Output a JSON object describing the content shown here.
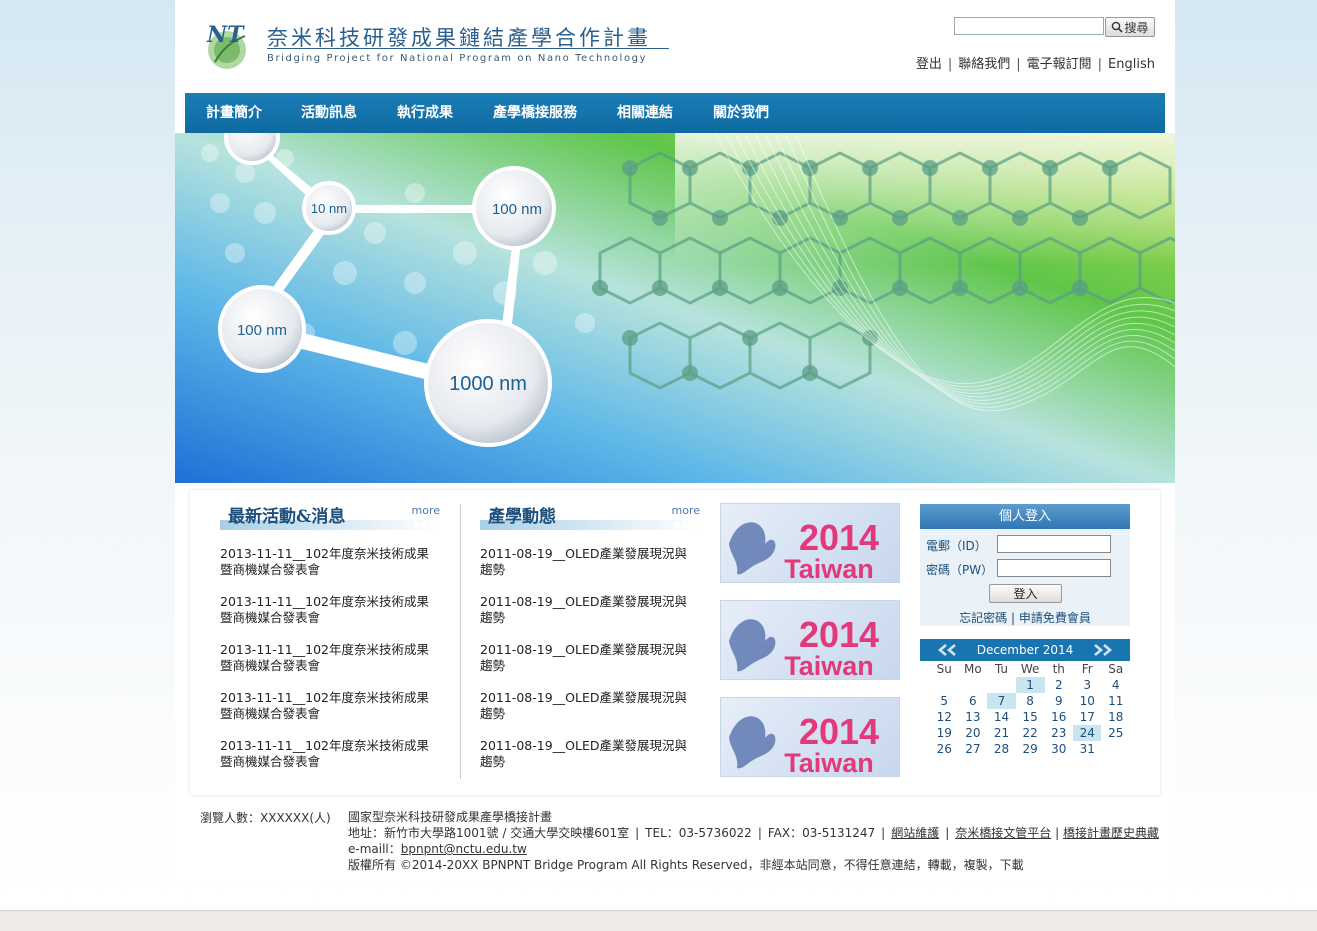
{
  "brand": {
    "logo_mark": "NT",
    "title_zh": "奈米科技研發成果鏈結產學合作計畫",
    "title_en": "Bridging Project for National Program on Nano Technology"
  },
  "search": {
    "placeholder": "",
    "button_label": "搜尋"
  },
  "top_links": [
    "登出",
    "聯絡我們",
    "電子報訂閱",
    "English"
  ],
  "nav": [
    "計畫簡介",
    "活動訊息",
    "執行成果",
    "產學橋接服務",
    "相關連結",
    "關於我們"
  ],
  "banner": {
    "labels": [
      "10 nm",
      "100 nm",
      "100 nm",
      "1000 nm"
    ]
  },
  "news": {
    "title": "最新活動&消息",
    "more": "more",
    "items": [
      [
        "2013-11-11__102年度奈米技術成果",
        "暨商機媒合發表會"
      ],
      [
        "2013-11-11__102年度奈米技術成果",
        "暨商機媒合發表會"
      ],
      [
        "2013-11-11__102年度奈米技術成果",
        "暨商機媒合發表會"
      ],
      [
        "2013-11-11__102年度奈米技術成果",
        "暨商機媒合發表會"
      ],
      [
        "2013-11-11__102年度奈米技術成果",
        "暨商機媒合發表會"
      ]
    ]
  },
  "industry": {
    "title": "產學動態",
    "more": "more",
    "items": [
      [
        "2011-08-19__OLED產業發展現況與",
        "趨勢"
      ],
      [
        "2011-08-19__OLED產業發展現況與",
        "趨勢"
      ],
      [
        "2011-08-19__OLED產業發展現況與",
        "趨勢"
      ],
      [
        "2011-08-19__OLED產業發展現況與",
        "趨勢"
      ],
      [
        "2011-08-19__OLED產業發展現況與",
        "趨勢"
      ]
    ]
  },
  "ads": [
    {
      "year": "2014",
      "text": "Taiwan"
    },
    {
      "year": "2014",
      "text": "Taiwan"
    },
    {
      "year": "2014",
      "text": "Taiwan"
    }
  ],
  "login": {
    "title": "個人登入",
    "id_label": "電郵（ID）",
    "pw_label": "密碼（PW）",
    "button": "登入",
    "forgot": "忘記密碼",
    "register": "申請免費會員"
  },
  "calendar": {
    "month_label": "December 2014",
    "weekdays": [
      "Su",
      "Mo",
      "Tu",
      "We",
      "th",
      "Fr",
      "Sa"
    ],
    "weeks": [
      [
        "",
        "",
        "",
        "1",
        "2",
        "3",
        "4"
      ],
      [
        "5",
        "6",
        "7",
        "8",
        "9",
        "10",
        "11"
      ],
      [
        "12",
        "13",
        "14",
        "15",
        "16",
        "17",
        "18"
      ],
      [
        "19",
        "20",
        "21",
        "22",
        "23",
        "24",
        "25"
      ],
      [
        "26",
        "27",
        "28",
        "29",
        "30",
        "31",
        ""
      ]
    ],
    "highlighted": [
      "1",
      "7",
      "24"
    ]
  },
  "footer": {
    "visitors": "瀏覽人數：XXXXXX(人)",
    "org": "國家型奈米科技研發成果產學橋接計畫",
    "address": "地址：新竹市大學路1001號 / 交通大學交映樓601室",
    "tel": "TEL：03-5736022",
    "fax": "FAX：03-5131247",
    "links": [
      "網站維護",
      "奈米橋接文管平台",
      "橋接計畫歷史典藏"
    ],
    "email_label": "e-maill：",
    "email": "bpnpnt@nctu.edu.tw",
    "copyright": "版權所有 ©2014-20XX BPNPNT Bridge Program All Rights Reserved，非經本站同意，不得任意連結，轉載，複製，下載"
  }
}
